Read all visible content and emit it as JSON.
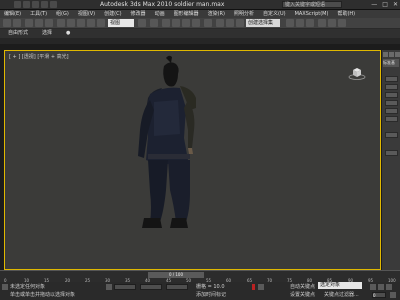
{
  "titlebar": {
    "title": "Autodesk 3ds Max  2010     soldier man.max",
    "search_placeholder": "键入关键字或短语",
    "window_buttons": [
      "—",
      "□",
      "✕"
    ]
  },
  "menubar": {
    "items": [
      "编辑(E)",
      "工具(T)",
      "组(G)",
      "视图(V)",
      "创建(C)",
      "修改器",
      "动画",
      "图形编辑器",
      "渲染(R)",
      "照明分析",
      "自定义(U)",
      "MAXScript(M)",
      "帮助(H)"
    ]
  },
  "toolbar": {
    "ref_coord": "视图",
    "named_selection": "创建选择集"
  },
  "ribbon": {
    "tabs": [
      "自由形式",
      "选择",
      "●"
    ]
  },
  "viewport": {
    "label": "[ + ] [透视] [平滑 + 高光]",
    "border_color": "#e0b800",
    "background": "#3b3b39"
  },
  "cmdpanel": {
    "header": "标准基"
  },
  "timeline": {
    "slider_label": "0 / 100",
    "tick_labels": [
      "0",
      "10",
      "15",
      "20",
      "25",
      "30",
      "35",
      "40",
      "45",
      "50",
      "55",
      "60",
      "65",
      "70",
      "75",
      "80",
      "85",
      "90",
      "95",
      "100"
    ]
  },
  "status": {
    "line1": "未选定任何对象",
    "line2": "单击或单击并拖动以选择对象",
    "add_time_tag": "添加时间标记",
    "grid": "栅格 = 10.0",
    "auto_key": "自动关键点",
    "set_key": "设置关键点",
    "key_filters": "关键点过滤器...",
    "selected_dropdown": "选定对象",
    "frame": "0"
  }
}
